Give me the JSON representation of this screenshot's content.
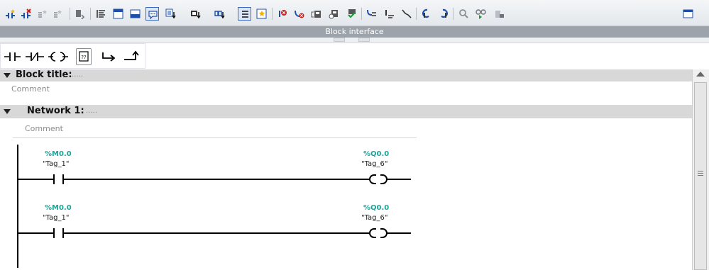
{
  "toolbar": {
    "icons": [
      "insert-network-icon",
      "delete-network-icon",
      "open-all-networks-icon",
      "close-all-networks-icon",
      "absolute-operands-icon",
      "network-overview-icon",
      "show-favorites-icon",
      "tag-information-icon",
      "network-comments-icon",
      "download-icon",
      "upload-icon",
      "go-online-icon",
      "monitoring-icon",
      "pin-icon",
      "favorites-icon",
      "go-to-error-icon",
      "remove-error-icon",
      "compare-icon",
      "check-icon",
      "go-to-previous-icon",
      "go-to-next-icon",
      "indent-icon",
      "monitor-on-icon",
      "monitor-all-icon",
      "call-environment-icon",
      "know-how-icon",
      "protection-icon",
      "memory-icon",
      "maximize-icon"
    ]
  },
  "interface_bar": {
    "label": "Block interface"
  },
  "favorites": [
    {
      "icon": "no-contact-icon",
      "name": "NO contact"
    },
    {
      "icon": "nc-contact-icon",
      "name": "NC contact"
    },
    {
      "icon": "coil-icon",
      "name": "Coil"
    },
    {
      "icon": "empty-box-icon",
      "name": "Empty box"
    },
    {
      "icon": "open-branch-icon",
      "name": "Open branch"
    },
    {
      "icon": "close-branch-icon",
      "name": "Close branch"
    }
  ],
  "block": {
    "title_label": "Block title:",
    "title_value": ".....",
    "comment": "Comment"
  },
  "network": {
    "title_label": "Network 1:",
    "title_value": ".....",
    "comment": "Comment",
    "rungs": [
      {
        "contact": {
          "address": "%M0.0",
          "tag": "\"Tag_1\""
        },
        "coil": {
          "address": "%Q0.0",
          "tag": "\"Tag_6\""
        }
      },
      {
        "contact": {
          "address": "%M0.0",
          "tag": "\"Tag_1\""
        },
        "coil": {
          "address": "%Q0.0",
          "tag": "\"Tag_6\""
        }
      }
    ]
  },
  "colors": {
    "operand": "#1aa59b",
    "header_bg": "#d8d8d8",
    "interface_bar": "#9ca3ab"
  }
}
